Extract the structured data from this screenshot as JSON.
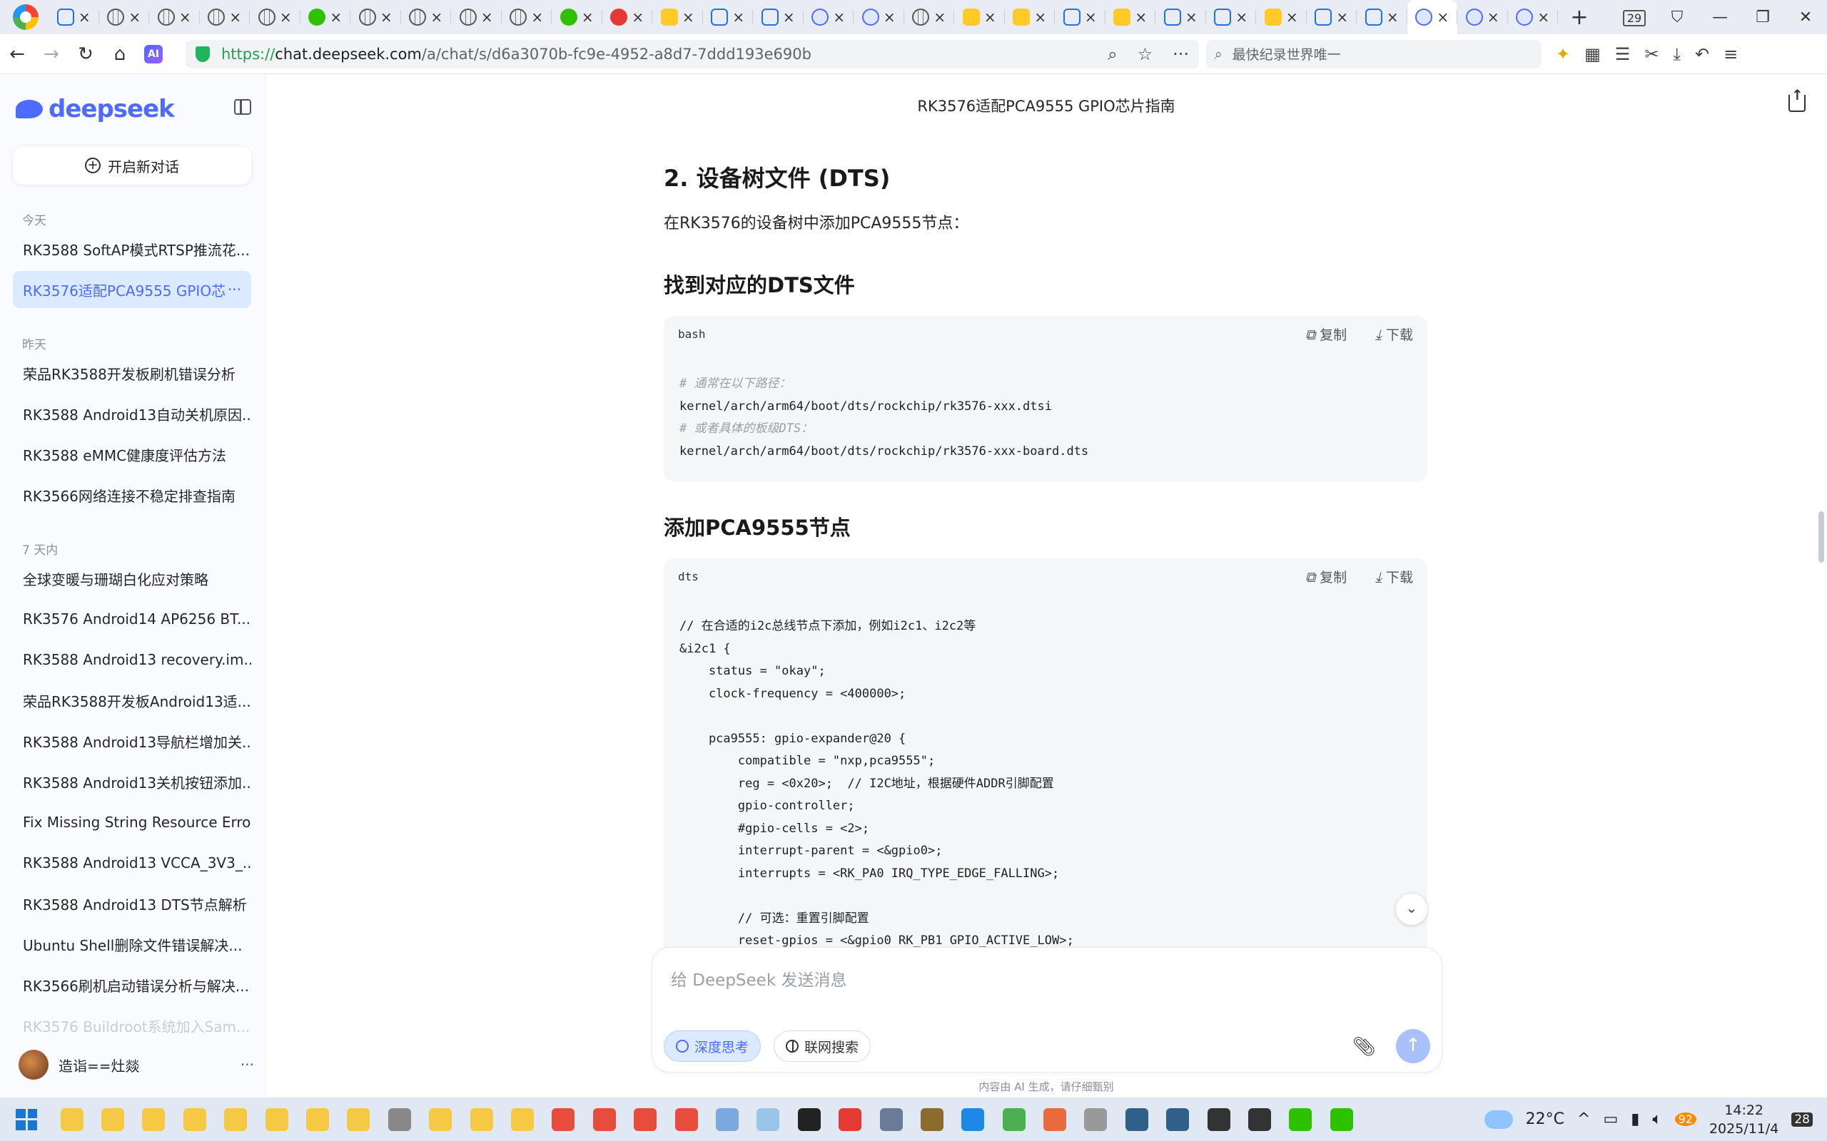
{
  "browser": {
    "tab_count_badge": "29",
    "address": {
      "scheme": "https://",
      "host": "chat.deepseek.com",
      "path": "/a/chat/s/d6a3070b-fc9e-4952-a8d7-7ddd193e690b"
    },
    "search_placeholder": "最快纪录世界唯一"
  },
  "sidebar": {
    "brand": "deepseek",
    "new_chat": "开启新对话",
    "sections": {
      "today": "今天",
      "yesterday": "昨天",
      "week": "7 天内"
    },
    "today_items": [
      "RK3588 SoftAP模式RTSP推流花...",
      "RK3576适配PCA9555 GPIO芯"
    ],
    "yesterday_items": [
      "荣品RK3588开发板刷机错误分析",
      "RK3588 Android13自动关机原因...",
      "RK3588 eMMC健康度评估方法",
      "RK3566网络连接不稳定排查指南"
    ],
    "week_items": [
      "全球变暖与珊瑚白化应对策略",
      "RK3576 Android14 AP6256 BT...",
      "RK3588 Android13 recovery.im...",
      "荣品RK3588开发板Android13适...",
      "RK3588 Android13导航栏增加关...",
      "RK3588 Android13关机按钮添加...",
      "Fix Missing String Resource Error",
      "RK3588 Android13 VCCA_3V3_...",
      "RK3588 Android13 DTS节点解析",
      "Ubuntu Shell删除文件错误解决...",
      "RK3566刷机启动错误分析与解决...",
      "RK3576 Buildroot系统加入Sam..."
    ],
    "more": "···",
    "user_name": "造诣==灶燚"
  },
  "chat": {
    "title": "RK3576适配PCA9555 GPIO芯片指南",
    "h2": "2. 设备树文件 (DTS)",
    "intro": "在RK3576的设备树中添加PCA9555节点：",
    "h3_find": "找到对应的DTS文件",
    "h3_add": "添加PCA9555节点",
    "copy_label": "复制",
    "download_label": "下载",
    "code1": {
      "lang": "bash",
      "comment1": "# 通常在以下路径：",
      "line1": "kernel/arch/arm64/boot/dts/rockchip/rk3576-xxx.dtsi",
      "comment2": "# 或者具体的板级DTS：",
      "line2": "kernel/arch/arm64/boot/dts/rockchip/rk3576-xxx-board.dts"
    },
    "code2": {
      "lang": "dts",
      "lines": [
        "// 在合适的i2c总线节点下添加，例如i2c1、i2c2等",
        "&i2c1 {",
        "    status = \"okay\";",
        "    clock-frequency = <400000>;",
        "",
        "    pca9555: gpio-expander@20 {",
        "        compatible = \"nxp,pca9555\";",
        "        reg = <0x20>;  // I2C地址，根据硬件ADDR引脚配置",
        "        gpio-controller;",
        "        #gpio-cells = <2>;",
        "        interrupt-parent = <&gpio0>;",
        "        interrupts = <RK_PA0 IRQ_TYPE_EDGE_FALLING>;",
        "",
        "        // 可选：重置引脚配置",
        "        reset-gpios = <&gpio0 RK_PB1 GPIO_ACTIVE_LOW>;"
      ]
    },
    "composer_placeholder": "给 DeepSeek 发送消息",
    "deep_think": "深度思考",
    "web_search": "联网搜索",
    "disclaimer": "内容由 AI 生成，请仔细甄别"
  },
  "taskbar": {
    "temperature": "22°C",
    "time": "14:22",
    "date": "2025/11/4",
    "battery_badge": "92",
    "notification_count": "28"
  }
}
